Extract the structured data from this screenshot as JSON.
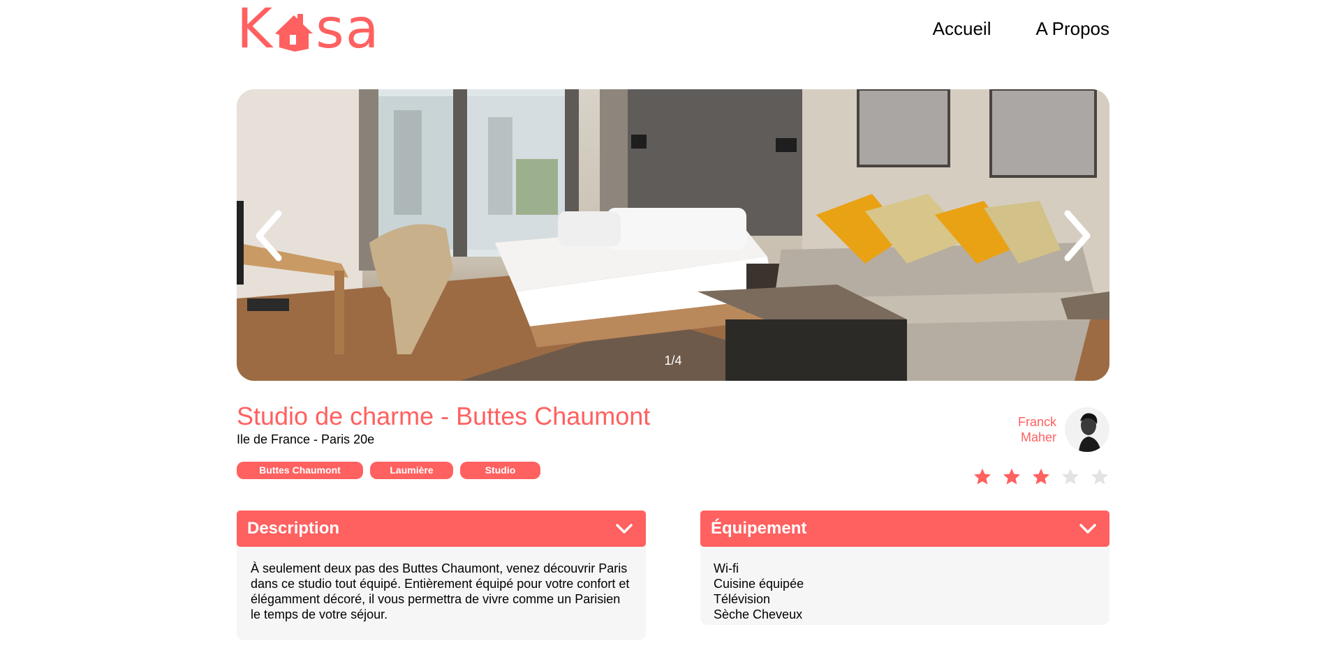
{
  "header": {
    "logo_left": "K",
    "logo_right": "sa",
    "nav": [
      {
        "label": "Accueil"
      },
      {
        "label": "A Propos"
      }
    ]
  },
  "gallery": {
    "counter": "1/4",
    "current_index": 1,
    "total": 4
  },
  "listing": {
    "title": "Studio de charme - Buttes Chaumont",
    "location": "Ile de France - Paris 20e",
    "tags": [
      "Buttes Chaumont",
      "Laumière",
      "Studio"
    ],
    "host": {
      "first_name": "Franck",
      "last_name": "Maher"
    },
    "rating": 3,
    "rating_max": 5
  },
  "description": {
    "title": "Description",
    "text": "À seulement deux pas des Buttes Chaumont, venez découvrir Paris dans ce studio tout équipé. Entièrement équipé pour votre confort et élégamment décoré, il vous permettra de vivre comme un Parisien le temps de votre séjour."
  },
  "equipment": {
    "title": "Équipement",
    "items": [
      "Wi-fi",
      "Cuisine équipée",
      "Télévision",
      "Sèche Cheveux"
    ]
  },
  "colors": {
    "accent": "#FF6060",
    "panel": "#F6F6F6",
    "star_inactive": "#E3E3E3"
  }
}
